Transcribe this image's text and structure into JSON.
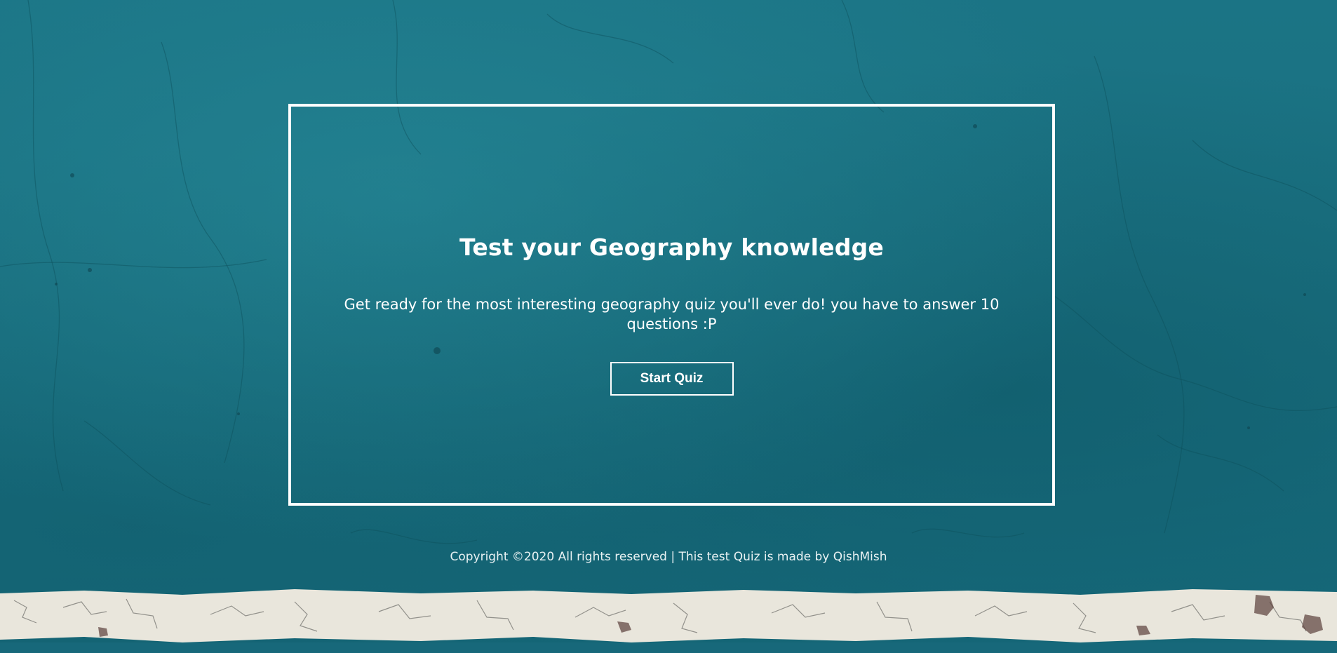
{
  "quiz": {
    "title": "Test your Geography knowledge",
    "description": "Get ready for the most interesting geography quiz you'll ever do! you have to answer 10 questions :P",
    "start_label": "Start Quiz"
  },
  "footer": {
    "text": "Copyright ©2020 All rights reserved | This test Quiz is made by QishMish"
  },
  "colors": {
    "background": "#1a7080",
    "panel_border": "#ffffff",
    "text": "#ffffff",
    "stripe": "#e9e6dc"
  }
}
